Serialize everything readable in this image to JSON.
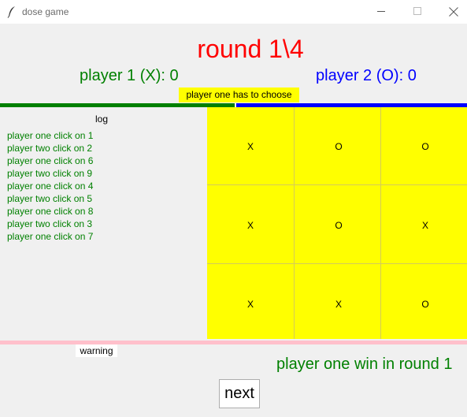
{
  "window": {
    "title": "dose game",
    "app_icon": "feather-icon",
    "controls": [
      "minimize-icon",
      "maximize-icon",
      "close-icon"
    ]
  },
  "round_title": "round 1\\4",
  "scores": {
    "player1": "player 1 (X): 0",
    "player2": "player 2 (O): 0"
  },
  "turn_label": "player one has to choose",
  "log": {
    "title": "log",
    "entries": [
      "player one click on 1",
      "player two click on 2",
      "player one click on 6",
      "player two click on 9",
      "player one click on 4",
      "player two click on 5",
      "player one click on 8",
      "player two click on 3",
      "player one click on 7"
    ]
  },
  "board": {
    "cells": [
      "X",
      "O",
      "O",
      "X",
      "O",
      "X",
      "X",
      "X",
      "O"
    ]
  },
  "warning_label": "warning",
  "result_message": "player one win in round 1",
  "next_button": "next",
  "colors": {
    "title": "#ff0000",
    "player1": "#008000",
    "player2": "#0000ff",
    "board": "#ffff00",
    "warning_bar": "#ffc0cb"
  }
}
